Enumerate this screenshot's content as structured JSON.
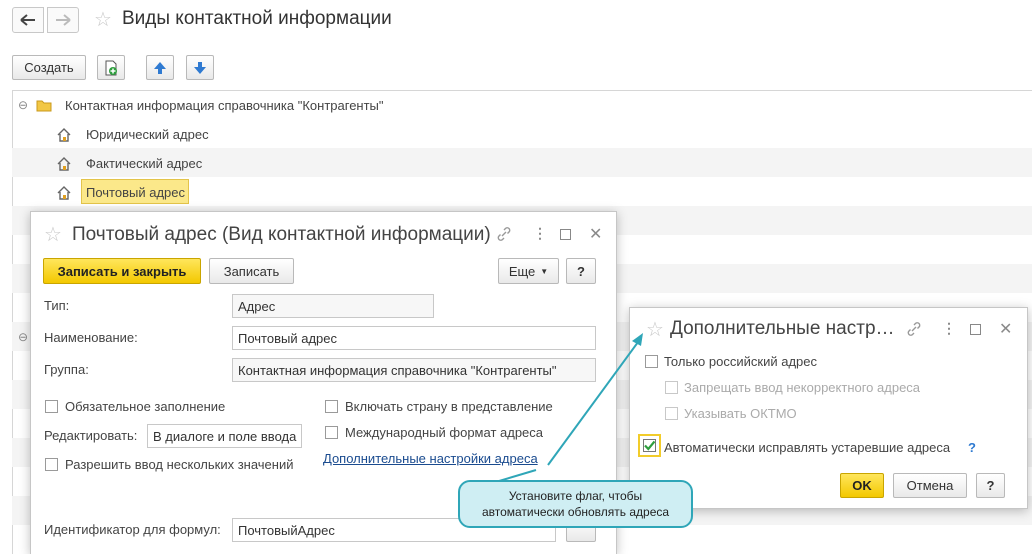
{
  "main": {
    "title": "Виды контактной информации",
    "create_label": "Создать",
    "tree": {
      "group_label": "Контактная информация справочника \"Контрагенты\"",
      "items": [
        "Юридический адрес",
        "Фактический адрес",
        "Почтовый адрес"
      ]
    }
  },
  "form": {
    "title": "Почтовый адрес (Вид контактной информации)",
    "save_close_label": "Записать и закрыть",
    "save_label": "Записать",
    "more_label": "Еще",
    "help_label": "?",
    "type_label": "Тип:",
    "type_value": "Адрес",
    "name_label": "Наименование:",
    "name_value": "Почтовый адрес",
    "group_label": "Группа:",
    "group_value": "Контактная информация справочника \"Контрагенты\"",
    "required_label": "Обязательное заполнение",
    "edit_label": "Редактировать:",
    "edit_value": "В диалоге и поле ввода",
    "multiple_label": "Разрешить ввод нескольких значений",
    "include_country_label": "Включать страну в представление",
    "intl_format_label": "Международный формат адреса",
    "extra_settings_link": "Дополнительные настройки адреса",
    "formula_id_label": "Идентификатор для формул:",
    "formula_id_value": "ПочтовыйАдрес"
  },
  "dialog": {
    "title": "Дополнительные настр…",
    "only_russian_label": "Только российский адрес",
    "forbid_incorrect_label": "Запрещать ввод некорректного адреса",
    "show_oktmo_label": "Указывать ОКТМО",
    "auto_fix_label": "Автоматически исправлять устаревшие адреса",
    "auto_fix_checked": true,
    "help_label": "?",
    "ok_label": "OK",
    "cancel_label": "Отмена"
  },
  "tooltip": {
    "text": "Установите флаг, чтобы автоматически обновлять адреса"
  }
}
